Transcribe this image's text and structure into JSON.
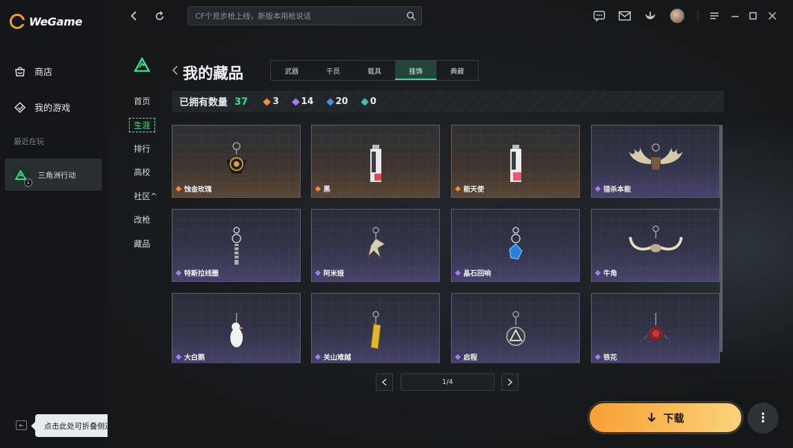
{
  "app": {
    "logo_text": "WeGame"
  },
  "sidebar": {
    "items": [
      {
        "label": "商店",
        "icon": "store-icon"
      },
      {
        "label": "我的游戏",
        "icon": "my-games-icon"
      }
    ],
    "recent_label": "最近在玩",
    "recent_game": {
      "label": "三角洲行动",
      "icon": "delta-force-icon"
    },
    "collapse_tooltip": "点击此处可折叠侧边栏"
  },
  "topbar": {
    "search_placeholder": "CF个竞步枪上线，新版本用枪说话"
  },
  "game_nav": {
    "items": [
      "首页",
      "生涯",
      "排行",
      "高校",
      "社区^",
      "改枪",
      "藏品"
    ],
    "active_index": 1
  },
  "page": {
    "title": "我的藏品",
    "tabs": [
      "武器",
      "干员",
      "载具",
      "挂饰",
      "典藏"
    ],
    "active_tab_index": 3
  },
  "counts": {
    "label": "已拥有数量",
    "total": "37",
    "rarities": [
      {
        "value": "3",
        "color": "#f08a3c"
      },
      {
        "value": "14",
        "color": "#a77bf0"
      },
      {
        "value": "20",
        "color": "#4a8ee8"
      },
      {
        "value": "0",
        "color": "#35c5b0"
      }
    ]
  },
  "items": [
    {
      "name": "蚀金玫瑰",
      "rarity": "orange",
      "art": "rose-medallion"
    },
    {
      "name": "黑",
      "rarity": "orange",
      "art": "card-tag"
    },
    {
      "name": "能天使",
      "rarity": "orange",
      "art": "card-tag"
    },
    {
      "name": "猎杀本能",
      "rarity": "purple",
      "art": "antlers"
    },
    {
      "name": "特斯拉线圈",
      "rarity": "purple",
      "art": "coil"
    },
    {
      "name": "阿米娅",
      "rarity": "purple",
      "art": "bird"
    },
    {
      "name": "晶石回响",
      "rarity": "purple",
      "art": "crystal"
    },
    {
      "name": "牛角",
      "rarity": "purple",
      "art": "horns"
    },
    {
      "name": "大白鹅",
      "rarity": "purple",
      "art": "goose"
    },
    {
      "name": "关山难越",
      "rarity": "purple",
      "art": "gold-bar"
    },
    {
      "name": "启程",
      "rarity": "purple",
      "art": "triangle-coin"
    },
    {
      "name": "铁花",
      "rarity": "purple",
      "art": "iron-flower"
    }
  ],
  "pager": {
    "text": "1/4"
  },
  "download": {
    "label": "下载"
  },
  "colors": {
    "accent_green": "#35e08a",
    "download_orange": "#f8a033"
  }
}
